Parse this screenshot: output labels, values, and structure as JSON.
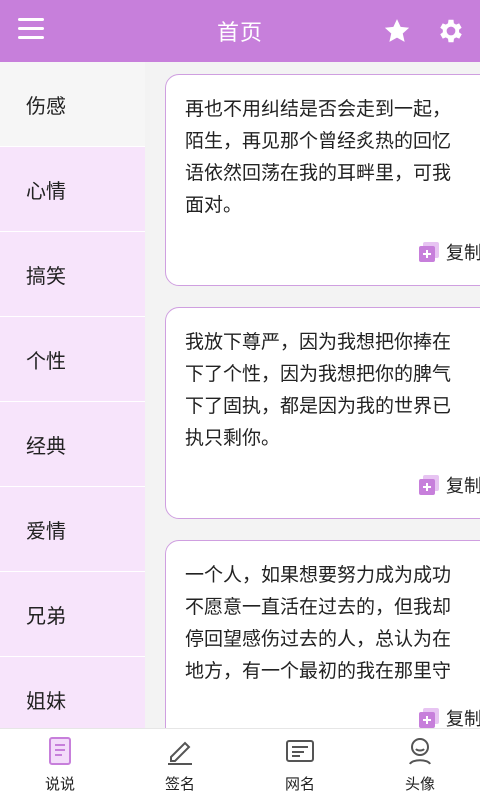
{
  "header": {
    "title": "首页",
    "menu_icon": "menu-icon",
    "star_icon": "star-icon",
    "settings_icon": "gear-icon"
  },
  "sidebar": {
    "items": [
      {
        "label": "伤感",
        "active": true
      },
      {
        "label": "心情"
      },
      {
        "label": "搞笑"
      },
      {
        "label": "个性"
      },
      {
        "label": "经典"
      },
      {
        "label": "爱情"
      },
      {
        "label": "兄弟"
      },
      {
        "label": "姐妹"
      }
    ]
  },
  "cards": [
    {
      "text": "再也不用纠结是否会走到一起，\n陌生，再见那个曾经炙热的回忆\n语依然回荡在我的耳畔里，可我\n面对。",
      "copy_label": "复制"
    },
    {
      "text": "我放下尊严，因为我想把你捧在\n下了个性，因为我想把你的脾气\n下了固执，都是因为我的世界已\n执只剩你。",
      "copy_label": "复制"
    },
    {
      "text": "一个人，如果想要努力成为成功\n不愿意一直活在过去的，但我却\n停回望感伤过去的人，总认为在\n地方，有一个最初的我在那里守",
      "copy_label": "复制"
    }
  ],
  "bottom_nav": {
    "items": [
      {
        "label": "说说",
        "icon": "document-icon"
      },
      {
        "label": "签名",
        "icon": "pen-icon"
      },
      {
        "label": "网名",
        "icon": "id-card-icon"
      },
      {
        "label": "头像",
        "icon": "avatar-icon"
      }
    ]
  },
  "colors": {
    "accent": "#c77fdb",
    "sidebar_bg": "#f7e4fb",
    "card_border": "#cf9fe0"
  }
}
